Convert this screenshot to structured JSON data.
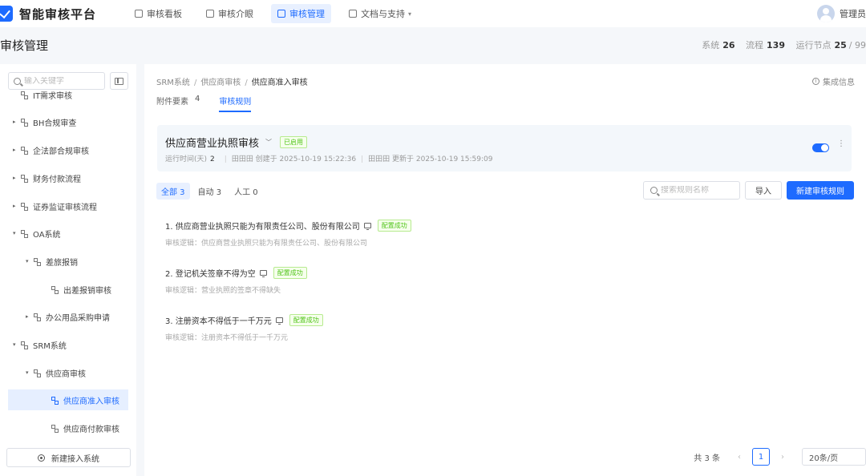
{
  "app": {
    "title": "智能审核平台"
  },
  "nav": [
    {
      "label": "审核看板",
      "icon": "dashboard-icon"
    },
    {
      "label": "审核介眼",
      "icon": "list-icon"
    },
    {
      "label": "审核管理",
      "icon": "monitor-icon",
      "active": true
    },
    {
      "label": "文档与支持",
      "icon": "doc-icon",
      "dropdown": true
    }
  ],
  "user": {
    "name": "管理员"
  },
  "page": {
    "title": "审核管理",
    "stats": [
      {
        "label": "系统",
        "value": "26"
      },
      {
        "label": "流程",
        "value": "139"
      },
      {
        "label": "运行节点",
        "value": "25",
        "suffix": "/ 99"
      }
    ]
  },
  "sidebar": {
    "search_placeholder": "输入关键字",
    "tree": [
      {
        "label": "IT需求审核",
        "level": 0,
        "arrow": ""
      },
      {
        "label": "BH合规审查",
        "level": 0,
        "arrow": "▸"
      },
      {
        "label": "企法部合规审核",
        "level": 0,
        "arrow": "▸"
      },
      {
        "label": "财务付款流程",
        "level": 0,
        "arrow": "▸"
      },
      {
        "label": "证券监证审核流程",
        "level": 0,
        "arrow": "▸"
      },
      {
        "label": "OA系统",
        "level": 0,
        "arrow": "▾"
      },
      {
        "label": "差旅报销",
        "level": 1,
        "arrow": "▾"
      },
      {
        "label": "出差报销审核",
        "level": 2,
        "arrow": ""
      },
      {
        "label": "办公用品采购申请",
        "level": 1,
        "arrow": "▸"
      },
      {
        "label": "SRM系统",
        "level": 0,
        "arrow": "▾"
      },
      {
        "label": "供应商审核",
        "level": 1,
        "arrow": "▾"
      },
      {
        "label": "供应商准入审核",
        "level": 2,
        "arrow": "",
        "active": true
      },
      {
        "label": "供应商付款审核",
        "level": 2,
        "arrow": ""
      }
    ],
    "new_button": "新建接入系统"
  },
  "main": {
    "breadcrumb": [
      "SRM系统",
      "供应商审核",
      "供应商准入审核"
    ],
    "integrate_label": "集成信息",
    "tabs": [
      {
        "label": "附件要素",
        "count": "4"
      },
      {
        "label": "审核规则",
        "count": "",
        "active": true
      }
    ],
    "rule_set": {
      "title": "供应商营业执照审核",
      "status": "已启用",
      "runtime_label": "运行时间(天)",
      "runtime_value": "2",
      "created": "田田田 创建于 2025-10-19 15:22:36",
      "updated": "田田田 更新于 2025-10-19 15:59:09",
      "enabled": true
    },
    "filters": [
      {
        "label": "全部 3",
        "active": true
      },
      {
        "label": "自动 3"
      },
      {
        "label": "人工 0"
      }
    ],
    "rule_search_placeholder": "搜索规则名称",
    "import_label": "导入",
    "new_rule_label": "新建审核规则",
    "rules": [
      {
        "title": "1. 供应商营业执照只能为有限责任公司、股份有限公司",
        "badge": "配置成功",
        "logic": "审核逻辑：供应商营业执照只能为有限责任公司、股份有限公司"
      },
      {
        "title": "2. 登记机关签章不得为空",
        "badge": "配置成功",
        "logic": "审核逻辑：营业执照的签章不得缺失"
      },
      {
        "title": "3. 注册资本不得低于一千万元",
        "badge": "配置成功",
        "logic": "审核逻辑：注册资本不得低于一千万元"
      }
    ],
    "pager": {
      "total": "共 3 条",
      "prev": "‹",
      "page": "1",
      "next": "›",
      "size": "20条/页"
    }
  }
}
